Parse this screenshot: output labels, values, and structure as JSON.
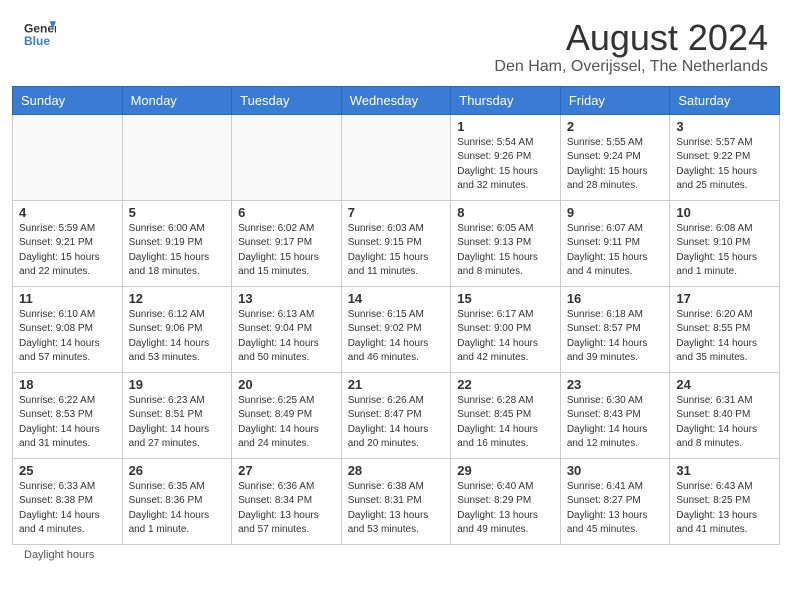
{
  "header": {
    "logo_general": "General",
    "logo_blue": "Blue",
    "title": "August 2024",
    "subtitle": "Den Ham, Overijssel, The Netherlands"
  },
  "days_of_week": [
    "Sunday",
    "Monday",
    "Tuesday",
    "Wednesday",
    "Thursday",
    "Friday",
    "Saturday"
  ],
  "daylight_note": "Daylight hours",
  "weeks": [
    [
      {
        "day": "",
        "sunrise": "",
        "sunset": "",
        "daylight": "",
        "empty": true
      },
      {
        "day": "",
        "sunrise": "",
        "sunset": "",
        "daylight": "",
        "empty": true
      },
      {
        "day": "",
        "sunrise": "",
        "sunset": "",
        "daylight": "",
        "empty": true
      },
      {
        "day": "",
        "sunrise": "",
        "sunset": "",
        "daylight": "",
        "empty": true
      },
      {
        "day": "1",
        "sunrise": "Sunrise: 5:54 AM",
        "sunset": "Sunset: 9:26 PM",
        "daylight": "Daylight: 15 hours and 32 minutes.",
        "empty": false
      },
      {
        "day": "2",
        "sunrise": "Sunrise: 5:55 AM",
        "sunset": "Sunset: 9:24 PM",
        "daylight": "Daylight: 15 hours and 28 minutes.",
        "empty": false
      },
      {
        "day": "3",
        "sunrise": "Sunrise: 5:57 AM",
        "sunset": "Sunset: 9:22 PM",
        "daylight": "Daylight: 15 hours and 25 minutes.",
        "empty": false
      }
    ],
    [
      {
        "day": "4",
        "sunrise": "Sunrise: 5:59 AM",
        "sunset": "Sunset: 9:21 PM",
        "daylight": "Daylight: 15 hours and 22 minutes.",
        "empty": false
      },
      {
        "day": "5",
        "sunrise": "Sunrise: 6:00 AM",
        "sunset": "Sunset: 9:19 PM",
        "daylight": "Daylight: 15 hours and 18 minutes.",
        "empty": false
      },
      {
        "day": "6",
        "sunrise": "Sunrise: 6:02 AM",
        "sunset": "Sunset: 9:17 PM",
        "daylight": "Daylight: 15 hours and 15 minutes.",
        "empty": false
      },
      {
        "day": "7",
        "sunrise": "Sunrise: 6:03 AM",
        "sunset": "Sunset: 9:15 PM",
        "daylight": "Daylight: 15 hours and 11 minutes.",
        "empty": false
      },
      {
        "day": "8",
        "sunrise": "Sunrise: 6:05 AM",
        "sunset": "Sunset: 9:13 PM",
        "daylight": "Daylight: 15 hours and 8 minutes.",
        "empty": false
      },
      {
        "day": "9",
        "sunrise": "Sunrise: 6:07 AM",
        "sunset": "Sunset: 9:11 PM",
        "daylight": "Daylight: 15 hours and 4 minutes.",
        "empty": false
      },
      {
        "day": "10",
        "sunrise": "Sunrise: 6:08 AM",
        "sunset": "Sunset: 9:10 PM",
        "daylight": "Daylight: 15 hours and 1 minute.",
        "empty": false
      }
    ],
    [
      {
        "day": "11",
        "sunrise": "Sunrise: 6:10 AM",
        "sunset": "Sunset: 9:08 PM",
        "daylight": "Daylight: 14 hours and 57 minutes.",
        "empty": false
      },
      {
        "day": "12",
        "sunrise": "Sunrise: 6:12 AM",
        "sunset": "Sunset: 9:06 PM",
        "daylight": "Daylight: 14 hours and 53 minutes.",
        "empty": false
      },
      {
        "day": "13",
        "sunrise": "Sunrise: 6:13 AM",
        "sunset": "Sunset: 9:04 PM",
        "daylight": "Daylight: 14 hours and 50 minutes.",
        "empty": false
      },
      {
        "day": "14",
        "sunrise": "Sunrise: 6:15 AM",
        "sunset": "Sunset: 9:02 PM",
        "daylight": "Daylight: 14 hours and 46 minutes.",
        "empty": false
      },
      {
        "day": "15",
        "sunrise": "Sunrise: 6:17 AM",
        "sunset": "Sunset: 9:00 PM",
        "daylight": "Daylight: 14 hours and 42 minutes.",
        "empty": false
      },
      {
        "day": "16",
        "sunrise": "Sunrise: 6:18 AM",
        "sunset": "Sunset: 8:57 PM",
        "daylight": "Daylight: 14 hours and 39 minutes.",
        "empty": false
      },
      {
        "day": "17",
        "sunrise": "Sunrise: 6:20 AM",
        "sunset": "Sunset: 8:55 PM",
        "daylight": "Daylight: 14 hours and 35 minutes.",
        "empty": false
      }
    ],
    [
      {
        "day": "18",
        "sunrise": "Sunrise: 6:22 AM",
        "sunset": "Sunset: 8:53 PM",
        "daylight": "Daylight: 14 hours and 31 minutes.",
        "empty": false
      },
      {
        "day": "19",
        "sunrise": "Sunrise: 6:23 AM",
        "sunset": "Sunset: 8:51 PM",
        "daylight": "Daylight: 14 hours and 27 minutes.",
        "empty": false
      },
      {
        "day": "20",
        "sunrise": "Sunrise: 6:25 AM",
        "sunset": "Sunset: 8:49 PM",
        "daylight": "Daylight: 14 hours and 24 minutes.",
        "empty": false
      },
      {
        "day": "21",
        "sunrise": "Sunrise: 6:26 AM",
        "sunset": "Sunset: 8:47 PM",
        "daylight": "Daylight: 14 hours and 20 minutes.",
        "empty": false
      },
      {
        "day": "22",
        "sunrise": "Sunrise: 6:28 AM",
        "sunset": "Sunset: 8:45 PM",
        "daylight": "Daylight: 14 hours and 16 minutes.",
        "empty": false
      },
      {
        "day": "23",
        "sunrise": "Sunrise: 6:30 AM",
        "sunset": "Sunset: 8:43 PM",
        "daylight": "Daylight: 14 hours and 12 minutes.",
        "empty": false
      },
      {
        "day": "24",
        "sunrise": "Sunrise: 6:31 AM",
        "sunset": "Sunset: 8:40 PM",
        "daylight": "Daylight: 14 hours and 8 minutes.",
        "empty": false
      }
    ],
    [
      {
        "day": "25",
        "sunrise": "Sunrise: 6:33 AM",
        "sunset": "Sunset: 8:38 PM",
        "daylight": "Daylight: 14 hours and 4 minutes.",
        "empty": false
      },
      {
        "day": "26",
        "sunrise": "Sunrise: 6:35 AM",
        "sunset": "Sunset: 8:36 PM",
        "daylight": "Daylight: 14 hours and 1 minute.",
        "empty": false
      },
      {
        "day": "27",
        "sunrise": "Sunrise: 6:36 AM",
        "sunset": "Sunset: 8:34 PM",
        "daylight": "Daylight: 13 hours and 57 minutes.",
        "empty": false
      },
      {
        "day": "28",
        "sunrise": "Sunrise: 6:38 AM",
        "sunset": "Sunset: 8:31 PM",
        "daylight": "Daylight: 13 hours and 53 minutes.",
        "empty": false
      },
      {
        "day": "29",
        "sunrise": "Sunrise: 6:40 AM",
        "sunset": "Sunset: 8:29 PM",
        "daylight": "Daylight: 13 hours and 49 minutes.",
        "empty": false
      },
      {
        "day": "30",
        "sunrise": "Sunrise: 6:41 AM",
        "sunset": "Sunset: 8:27 PM",
        "daylight": "Daylight: 13 hours and 45 minutes.",
        "empty": false
      },
      {
        "day": "31",
        "sunrise": "Sunrise: 6:43 AM",
        "sunset": "Sunset: 8:25 PM",
        "daylight": "Daylight: 13 hours and 41 minutes.",
        "empty": false
      }
    ]
  ]
}
